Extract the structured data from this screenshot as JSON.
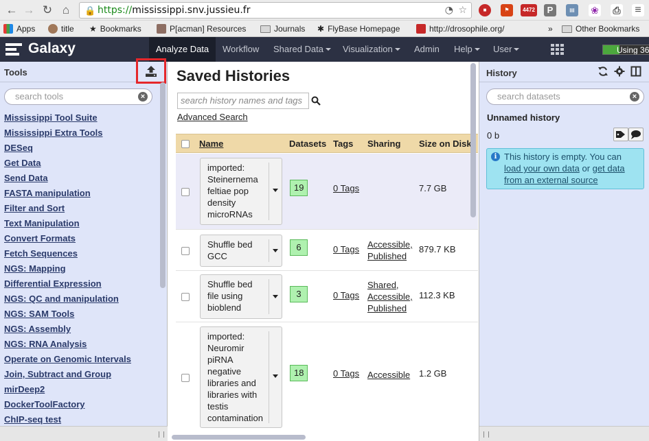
{
  "browser": {
    "url_protocol": "https://",
    "url_rest": "mississippi.snv.jussieu.fr",
    "ext_badge": "4472"
  },
  "bookmarks": {
    "apps": "Apps",
    "title": "title",
    "bookmarks": "Bookmarks",
    "resources": "P[acman] Resources",
    "journals": "Journals",
    "flybase": "FlyBase Homepage",
    "droso": "http://drosophile.org/",
    "more": "»",
    "other": "Other Bookmarks"
  },
  "galaxy": {
    "brand": "Galaxy",
    "tabs": [
      "Analyze Data",
      "Workflow",
      "Shared Data",
      "Visualization",
      "Admin",
      "Help",
      "User"
    ],
    "quota_label": "Using 36",
    "quota_fraction": 0.36
  },
  "tools": {
    "title": "Tools",
    "search_placeholder": "search tools",
    "items": [
      "Mississippi Tool Suite",
      "Mississippi Extra Tools",
      "DESeq",
      "Get Data",
      "Send Data",
      "FASTA manipulation",
      "Filter and Sort",
      "Text Manipulation",
      "Convert Formats",
      "Fetch Sequences",
      "NGS: Mapping",
      "Differential Expression",
      "NGS: QC and manipulation",
      "NGS: SAM Tools",
      "NGS: Assembly",
      "NGS: RNA Analysis",
      "Operate on Genomic Intervals",
      "Join, Subtract and Group",
      "mirDeep2",
      "DockerToolFactory",
      "ChIP-seq test"
    ]
  },
  "saved": {
    "title": "Saved Histories",
    "search_placeholder": "search history names and tags",
    "advanced": "Advanced Search",
    "columns": [
      "Name",
      "Datasets",
      "Tags",
      "Sharing",
      "Size on Disk"
    ],
    "rows": [
      {
        "name": "imported: Steinernema feltiae pop density microRNAs",
        "datasets": "19",
        "tags": "0 Tags",
        "sharing": "",
        "size": "7.7 GB"
      },
      {
        "name": "Shuffle bed GCC",
        "datasets": "6",
        "tags": "0 Tags",
        "sharing": "Accessible, Published",
        "size": "879.7 KB"
      },
      {
        "name": "Shuffle bed file using bioblend",
        "datasets": "3",
        "tags": "0 Tags",
        "sharing": "Shared, Accessible, Published",
        "size": "112.3 KB"
      },
      {
        "name": "imported: Neuromir piRNA negative libraries and libraries with testis contamination",
        "datasets": "18",
        "tags": "0 Tags",
        "sharing": "Accessible",
        "size": "1.2 GB"
      }
    ]
  },
  "history": {
    "title": "History",
    "search_placeholder": "search datasets",
    "name": "Unnamed history",
    "size": "0 b",
    "empty_prefix": "This history is empty. You can",
    "empty_link1": "load your own data",
    "empty_or": "or",
    "empty_link2": "get data from an external source"
  }
}
